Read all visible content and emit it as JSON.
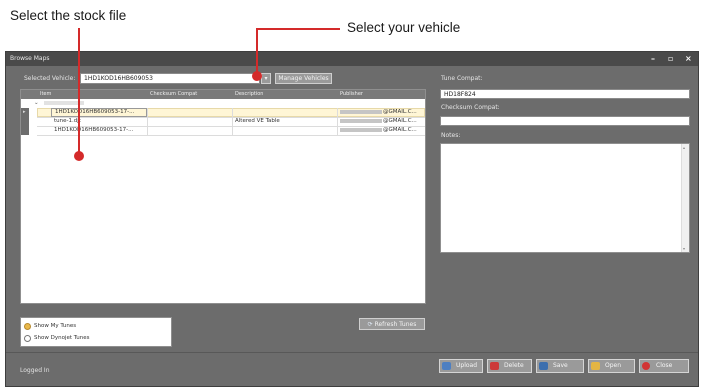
{
  "annotations": {
    "select_stock_file": "Select the stock file",
    "select_vehicle": "Select your vehicle"
  },
  "window": {
    "title": "Browse Maps",
    "min": "–",
    "max": "▫",
    "close": "×"
  },
  "vehicle": {
    "label": "Selected Vehicle:",
    "value": "1HD1KOD16HB609053",
    "manage_label": "Manage Vehicles"
  },
  "grid": {
    "columns": [
      "Item",
      "Checksum Compat",
      "Description",
      "Publisher"
    ],
    "rows": [
      {
        "item": "1HD1KOD16HB609053-17-...",
        "description": "",
        "publisher": "@GMAIL.C..."
      },
      {
        "item": "tune-1.djt",
        "description": "Altered VE Table",
        "publisher": "@GMAIL.C..."
      },
      {
        "item": "1HD1KOD16HB609053-17-...",
        "description": "",
        "publisher": "@GMAIL.C..."
      }
    ]
  },
  "right_panel": {
    "tune_compat_label": "Tune Compat:",
    "tune_compat_value": "HD18F824",
    "checksum_label": "Checksum Compat:",
    "checksum_value": "",
    "notes_label": "Notes:"
  },
  "filters": {
    "show_my_tunes": "Show My Tunes",
    "show_dynojet_tunes": "Show Dynojet Tunes",
    "refresh_label": "Refresh Tunes"
  },
  "status": {
    "text": "Logged In"
  },
  "buttons": {
    "upload": "Upload",
    "delete": "Delete",
    "save": "Save",
    "open": "Open",
    "close": "Close"
  },
  "colors": {
    "accent_red": "#d42a2a",
    "selection": "#fff6d6",
    "radio_on": "#e9b84a"
  }
}
